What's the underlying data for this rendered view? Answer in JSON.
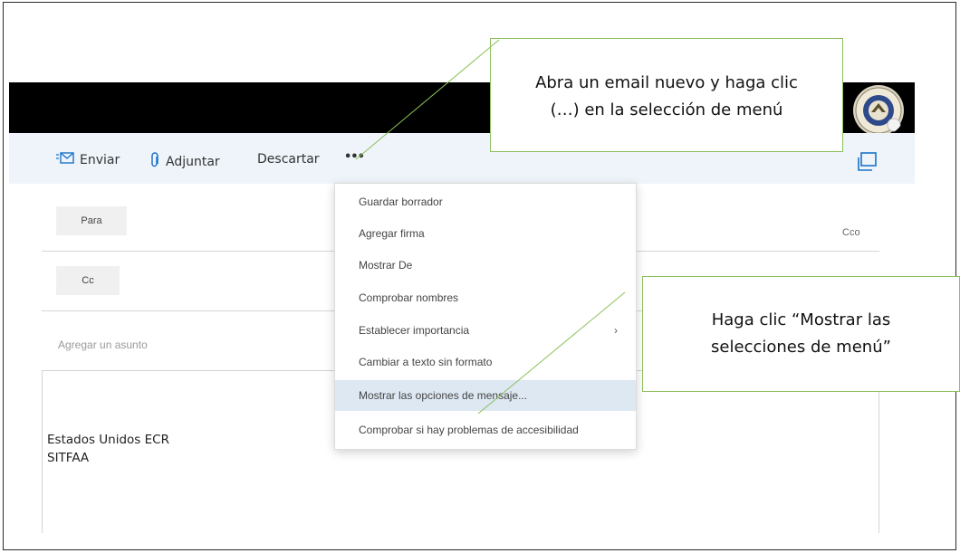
{
  "toolbar": {
    "send_label": "Enviar",
    "attach_label": "Adjuntar",
    "discard_label": "Descartar",
    "more_label": "•••",
    "send_icon": "envelope-send-icon",
    "attach_icon": "paperclip-icon",
    "popout_icon": "popout-window-icon"
  },
  "recipients": {
    "to_label": "Para",
    "cc_label": "Cc",
    "bcc_label": "Cco"
  },
  "subject": {
    "placeholder": "Agregar un asunto"
  },
  "signature": {
    "line1": "Estados Unidos  ECR",
    "line2": "SITFAA"
  },
  "menu": {
    "items": [
      {
        "label": "Guardar borrador"
      },
      {
        "label": "Agregar firma"
      },
      {
        "label": "Mostrar De"
      },
      {
        "label": "Comprobar nombres"
      },
      {
        "label": "Establecer importancia",
        "submenu": "›"
      },
      {
        "label": "Cambiar a texto sin formato"
      },
      {
        "label": "Mostrar las opciones de mensaje..."
      },
      {
        "label": "Comprobar si hay problemas de accesibilidad"
      }
    ],
    "highlighted_index": 6
  },
  "callouts": {
    "first_line1": "Abra un email nuevo y haga clic",
    "first_line2": "(…) en la selección de menú",
    "second_line1": "Haga clic “Mostrar las",
    "second_line2": "selecciones de menú”"
  },
  "colors": {
    "topbar": "#000000",
    "toolbar_bg": "#eef4fa",
    "accent_blue": "#1a73c8",
    "menu_highlight": "#dde8f3",
    "callout_border": "#8cbf5a"
  }
}
